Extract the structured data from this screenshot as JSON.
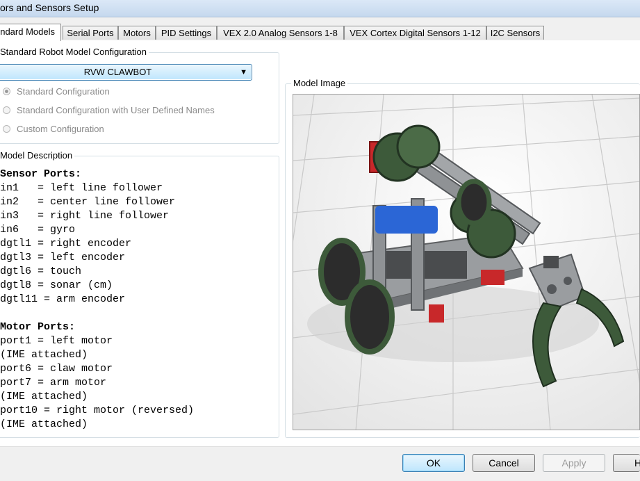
{
  "window": {
    "title": "ors and Sensors Setup"
  },
  "tabs": [
    {
      "label": "ndard Models"
    },
    {
      "label": "Serial Ports"
    },
    {
      "label": "Motors"
    },
    {
      "label": "PID Settings"
    },
    {
      "label": "VEX 2.0 Analog Sensors 1-8"
    },
    {
      "label": "VEX Cortex Digital Sensors 1-12"
    },
    {
      "label": "I2C Sensors"
    }
  ],
  "config": {
    "group_label": "Standard Robot Model Configuration",
    "model_select": "RVW CLAWBOT",
    "options": [
      {
        "label": "Standard Configuration",
        "selected": true
      },
      {
        "label": "Standard Configuration with User Defined Names",
        "selected": false
      },
      {
        "label": "Custom Configuration",
        "selected": false
      }
    ]
  },
  "description": {
    "group_label": "Model Description",
    "sensor_header": "Sensor Ports:",
    "sensor_lines": [
      "in1   = left line follower",
      "in2   = center line follower",
      "in3   = right line follower",
      "in6   = gyro",
      "dgtl1 = right encoder",
      "dgtl3 = left encoder",
      "dgtl6 = touch",
      "dgtl8 = sonar (cm)",
      "dgtl11 = arm encoder"
    ],
    "motor_header": "Motor Ports:",
    "motor_lines": [
      "port1 = left motor",
      "(IME attached)",
      "port6 = claw motor",
      "port7 = arm motor",
      "(IME attached)",
      "port10 = right motor (reversed)",
      "(IME attached)"
    ]
  },
  "image": {
    "group_label": "Model Image"
  },
  "buttons": {
    "ok": "OK",
    "cancel": "Cancel",
    "apply": "Apply",
    "help": "H"
  },
  "colors": {
    "robot_green": "#3d5a3a",
    "robot_red": "#c8282a",
    "robot_blue": "#2b66d6",
    "metal": "#8c8f92"
  }
}
